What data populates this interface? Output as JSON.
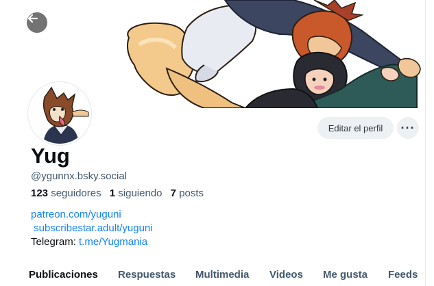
{
  "profile": {
    "display_name": "Yug",
    "handle": "@ygunnx.bsky.social",
    "stats": {
      "followers_count": "123",
      "followers_label": "seguidores",
      "following_count": "1",
      "following_label": "siguiendo",
      "posts_count": "7",
      "posts_label": "posts"
    },
    "bio": {
      "link1": "patreon.com/yuguni",
      "link2": "subscribestar.adult/yuguni",
      "telegram_label": "Telegram: ",
      "telegram_link": "t.me/Yugmania"
    }
  },
  "actions": {
    "edit_profile": "Editar el perfil",
    "more_label": "···"
  },
  "tabs": [
    {
      "label": "Publicaciones",
      "active": true
    },
    {
      "label": "Respuestas",
      "active": false
    },
    {
      "label": "Multimedia",
      "active": false
    },
    {
      "label": "Videos",
      "active": false
    },
    {
      "label": "Me gusta",
      "active": false
    },
    {
      "label": "Feeds",
      "active": false
    }
  ],
  "colors": {
    "link": "#1083fe",
    "muted_text": "#42576c",
    "primary_text": "#0b0f14",
    "button_bg": "#eef1f4"
  },
  "icons": {
    "back": "arrow-left-icon",
    "more": "ellipsis-icon"
  }
}
